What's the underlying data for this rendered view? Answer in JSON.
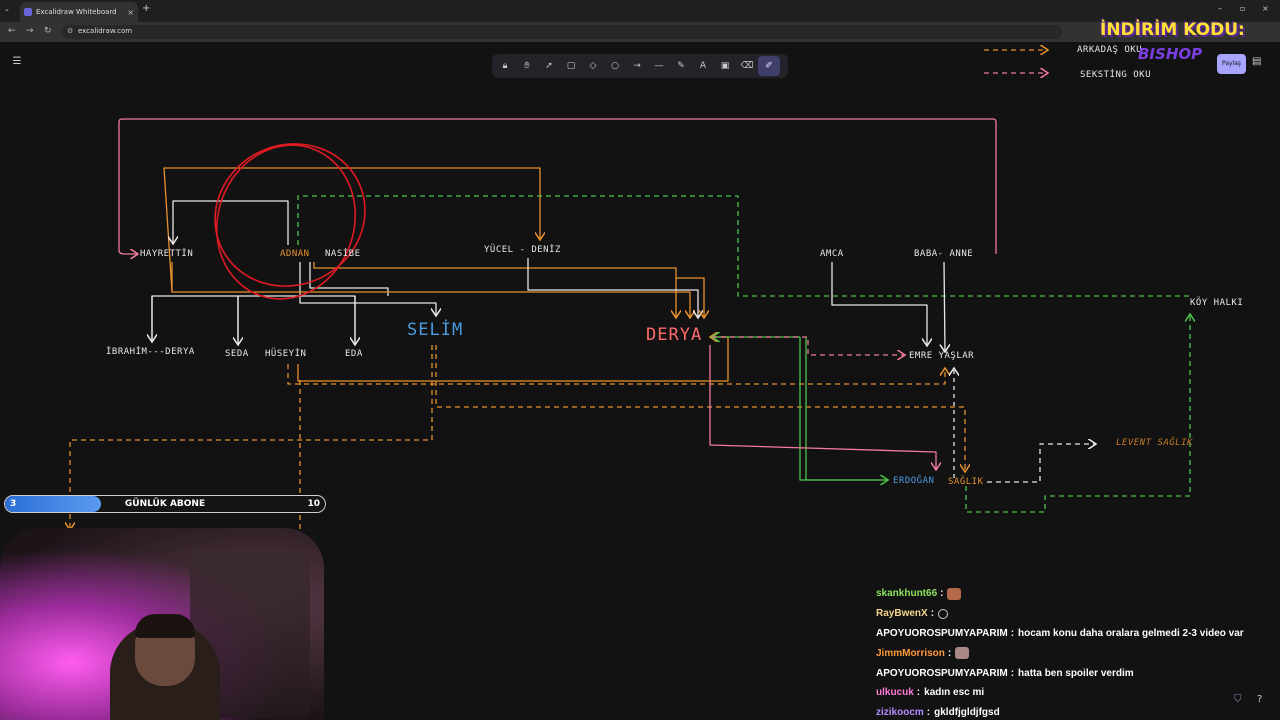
{
  "browser": {
    "tab_title": "Excalidraw Whiteboard",
    "url": "excalidraw.com",
    "new_tab": "+",
    "tab_close": "×",
    "tab_menu": "⌄",
    "window_controls": [
      "–",
      "▫",
      "×"
    ],
    "nav": [
      "←",
      "→",
      "↻"
    ]
  },
  "excalidraw": {
    "share_label": "Paylaş",
    "tools": [
      "lock-icon",
      "hand-icon",
      "selection-icon",
      "rectangle-icon",
      "diamond-icon",
      "ellipse-icon",
      "arrow-icon",
      "line-icon",
      "draw-icon",
      "text-icon",
      "image-icon",
      "eraser-icon",
      "laser-icon"
    ],
    "active_tool": "laser-icon"
  },
  "diagram": {
    "nodes": {
      "hayrettin": "HAYRETTİN",
      "adnan": "ADNAN",
      "nasibe": "NASİBE",
      "yucel_deniz": "YÜCEL - DENİZ",
      "amca": "AMCA",
      "baba_anne": "BABA- ANNE",
      "koy_halki": "KÖY HALKI",
      "ibrahim_derya": "İBRAHİM---DERYA",
      "seda": "SEDA",
      "huseyin": "HÜSEYİN",
      "eda": "EDA",
      "selim": "SELİM",
      "derya": "DERYA",
      "emre_yaslar": "EMRE YAŞLAR",
      "erdogan": "ERDOĞAN",
      "saglik": "SAĞLIK",
      "levent_saglik": "LEVENT SAĞLIK"
    },
    "legend": [
      {
        "label": "ARKADAŞ OKU",
        "color": "#e8912d"
      },
      {
        "label": "SEKSTİNG OKU",
        "color": "#f07a9a"
      }
    ],
    "colors": {
      "white_arrow": "#e8e8e8",
      "orange_arrow": "#e8912d",
      "pink_arrow": "#f07a9a",
      "green_arrow": "#4cc24c",
      "red_circle": "#e01b24",
      "blue_text": "#4a9be0"
    }
  },
  "overlay": {
    "promo_title": "İNDİRİM KODU:",
    "promo_code": "BISHOP",
    "sub_goal": {
      "label": "GÜNLÜK ABONE",
      "current": 3,
      "goal": 10,
      "progress": 0.3
    },
    "chat": [
      {
        "user": "skankhunt66",
        "color": "#8ee35f",
        "msg": "",
        "emote": "emote"
      },
      {
        "user": "RayBwenX",
        "color": "#f4d58d",
        "msg": "",
        "emote": "spin"
      },
      {
        "user": "APOYUOROSPUMYAPARIM",
        "color": "#ffffff",
        "msg": "hocam konu daha oralara gelmedi 2-3 video var",
        "emote": ""
      },
      {
        "user": "JimmMorrison",
        "color": "#ff9a3c",
        "msg": "",
        "emote": "cat"
      },
      {
        "user": "APOYUOROSPUMYAPARIM",
        "color": "#ffffff",
        "msg": "hatta ben spoiler verdim",
        "emote": ""
      },
      {
        "user": "ulkucuk",
        "color": "#ff7ad9",
        "msg": "kadın esc mi",
        "emote": ""
      },
      {
        "user": "zizikoocm",
        "color": "#b58cff",
        "msg": "gkldfjgldjfgsd",
        "emote": ""
      }
    ]
  }
}
